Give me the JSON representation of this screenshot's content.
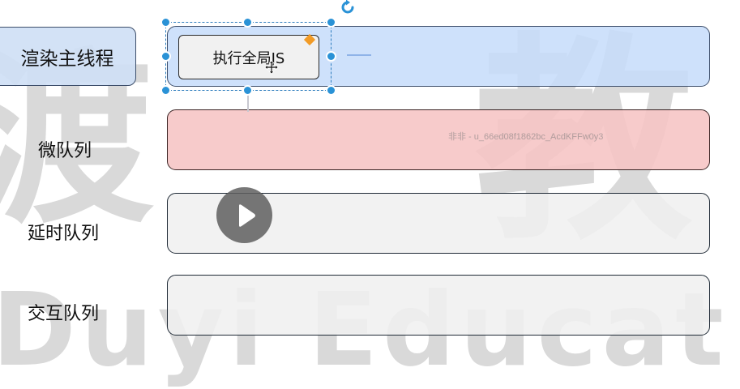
{
  "lanes": {
    "main_thread": "渲染主线程",
    "microtask_queue": "微队列",
    "delay_queue": "延时队列",
    "interaction_queue": "交互队列"
  },
  "task_box": {
    "label": "执行全局JS"
  },
  "watermark": {
    "user": "非非 - u_66ed08f1862bc_AcdKFFw0y3",
    "logo_cn_left": "渡",
    "logo_cn_right": "教",
    "logo_en": "Duyi Educat"
  },
  "video": {
    "play_icon": "play-icon"
  },
  "colors": {
    "main_lane": "#c6dcfa",
    "micro_lane": "#f6c4c4",
    "empty_lane": "#f0f0f0",
    "selection": "#2a92d6",
    "diamond": "#f29b26"
  }
}
